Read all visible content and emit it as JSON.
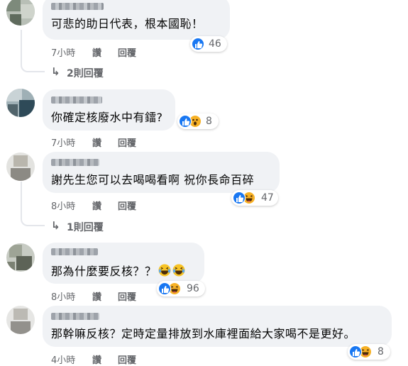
{
  "comments": [
    {
      "text": "可悲的助日代表，根本國恥！",
      "time": "7小時",
      "like_label": "讚",
      "reply_label": "回覆",
      "reactions": [
        "like"
      ],
      "reaction_count": "46",
      "replies_label": "2則回覆"
    },
    {
      "text": "你確定核廢水中有鐳?",
      "time": "7小時",
      "like_label": "讚",
      "reply_label": "回覆",
      "reactions": [
        "like",
        "wow"
      ],
      "reaction_count": "8"
    },
    {
      "text": "謝先生您可以去喝喝看啊 祝你長命百碎",
      "time": "8小時",
      "like_label": "讚",
      "reply_label": "回覆",
      "reactions": [
        "like",
        "haha"
      ],
      "reaction_count": "47",
      "replies_label": "1則回覆"
    },
    {
      "text": "那為什麼要反核？？",
      "inline_emojis": [
        "laughing-crying-emoji",
        "laughing-crying-emoji"
      ],
      "time": "8小時",
      "like_label": "讚",
      "reply_label": "回覆",
      "reactions": [
        "like",
        "haha"
      ],
      "reaction_count": "96"
    },
    {
      "text": "那幹嘛反核？定時定量排放到水庫裡面給大家喝不是更好。",
      "time": "4小時",
      "like_label": "讚",
      "reply_label": "回覆",
      "reactions": [
        "like",
        "haha"
      ],
      "reaction_count": "8"
    }
  ],
  "icons": {
    "like": "thumbs-up-icon",
    "wow": "wow-face-icon",
    "haha": "haha-face-icon",
    "reply_arrow": "reply-arrow-icon"
  },
  "colors": {
    "bubble": "#f0f2f5",
    "meta_text": "#65676b",
    "like_blue": "#1877f2",
    "emoji_yellow": "#f7b125"
  }
}
